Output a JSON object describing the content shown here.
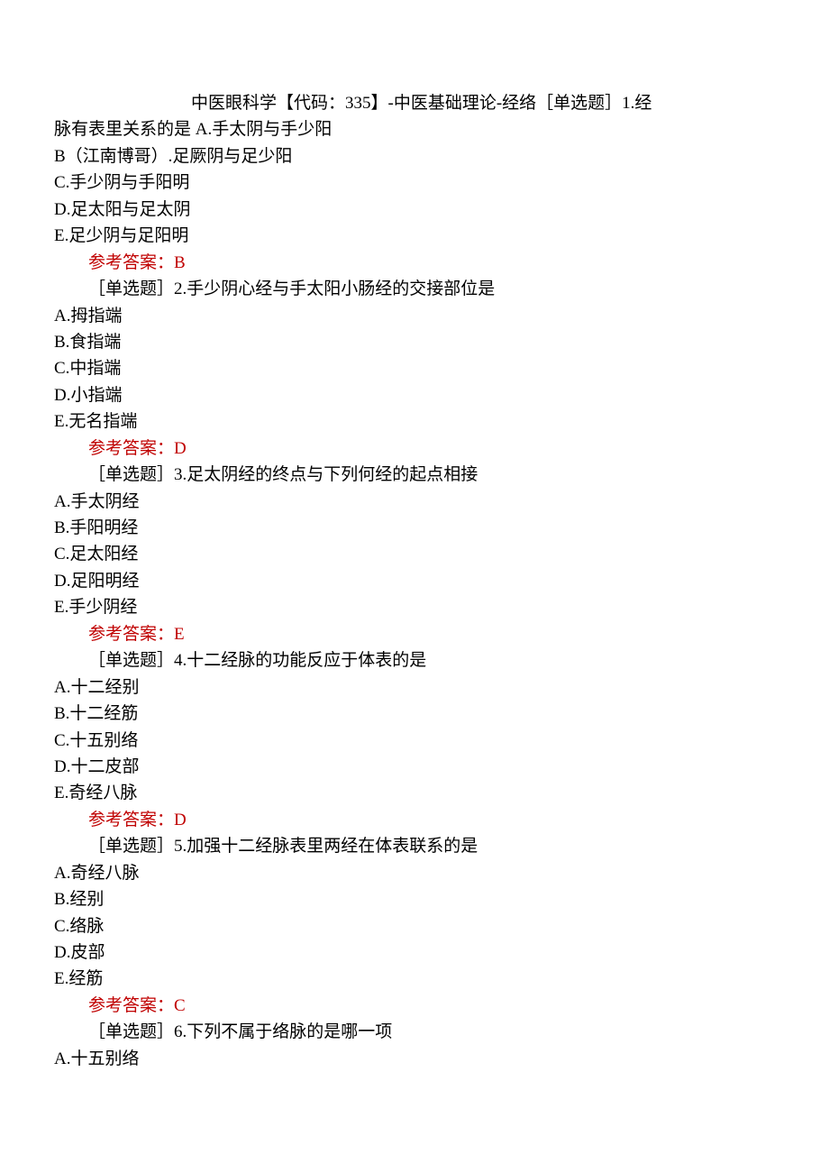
{
  "title_prefix": "中医眼科学【代码：335】-中医基础理论-经络［单选题］1.经",
  "title_cont": "脉有表里关系的是 A.手太阴与手少阳",
  "q1": {
    "B": "B（江南博哥）.足厥阴与足少阳",
    "C": "C.手少阴与手阳明",
    "D": "D.足太阳与足太阴",
    "E": "E.足少阴与足阳明",
    "ans": "参考答案：B"
  },
  "q2": {
    "stem": "［单选题］2.手少阴心经与手太阳小肠经的交接部位是",
    "A": "A.拇指端",
    "B": "B.食指端",
    "C": "C.中指端",
    "D": "D.小指端",
    "E": "E.无名指端",
    "ans": "参考答案：D"
  },
  "q3": {
    "stem": "［单选题］3.足太阴经的终点与下列何经的起点相接",
    "A": "A.手太阴经",
    "B": "B.手阳明经",
    "C": "C.足太阳经",
    "D": "D.足阳明经",
    "E": "E.手少阴经",
    "ans": "参考答案：E"
  },
  "q4": {
    "stem": "［单选题］4.十二经脉的功能反应于体表的是",
    "A": "A.十二经别",
    "B": "B.十二经筋",
    "C": "C.十五别络",
    "D": "D.十二皮部",
    "E": "E.奇经八脉",
    "ans": "参考答案：D"
  },
  "q5": {
    "stem": "［单选题］5.加强十二经脉表里两经在体表联系的是",
    "A": "A.奇经八脉",
    "B": "B.经别",
    "C": "C.络脉",
    "D": "D.皮部",
    "E": "E.经筋",
    "ans": "参考答案：C"
  },
  "q6": {
    "stem": "［单选题］6.下列不属于络脉的是哪一项",
    "A": "A.十五别络"
  }
}
